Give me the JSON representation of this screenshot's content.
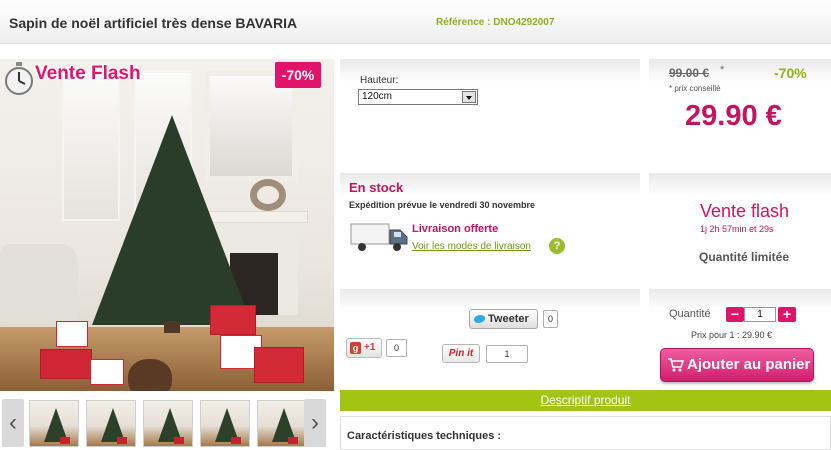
{
  "header": {
    "title": "Sapin de noël artificiel très dense BAVARIA",
    "reference": "Référence : DNO4292007"
  },
  "image": {
    "flash_label": "Vente Flash",
    "discount_badge": "-70%",
    "thumbnail_count": 5
  },
  "options": {
    "height_label": "Hauteur:",
    "height_value": "120cm"
  },
  "pricing": {
    "old_price": "99.00 €",
    "asterisk": "*",
    "discount": "-70%",
    "note": "* prix conseillé",
    "price": "29.90 €"
  },
  "stock": {
    "status": "En stock",
    "shipping": "Expédition prévue le vendredi 30 novembre",
    "delivery": "Livraison offerte",
    "delivery_link": "Voir les modes de livraison",
    "help": "?"
  },
  "flash": {
    "title": "Vente flash",
    "timer": "1j 2h 57min et 29s",
    "limited": "Quantité limitée"
  },
  "social": {
    "tweet_label": "Tweeter",
    "tweet_count": "0",
    "gplus_label": "+1",
    "gplus_count": "0",
    "pin_label": "Pin it",
    "pin_count": "1"
  },
  "cart": {
    "qty_label": "Quantité",
    "minus": "−",
    "plus": "+",
    "qty_value": "1",
    "unit_price": "Prix pour 1 : 29.90 €",
    "add_label": "Ajouter au panier"
  },
  "description": {
    "tab_label": "Descriptif produit",
    "caracteristiques": "Caractéristiques techniques :"
  },
  "colors": {
    "brand_pink": "#e2136a",
    "price_pink": "#c4135f",
    "accent_green": "#a3c315"
  },
  "icons": [
    "stopwatch-icon",
    "dropdown-arrow-icon",
    "delivery-truck-icon",
    "help-icon",
    "twitter-bird-icon",
    "google-plus-icon",
    "pinterest-icon",
    "cart-icon",
    "chevron-left-icon",
    "chevron-right-icon"
  ]
}
